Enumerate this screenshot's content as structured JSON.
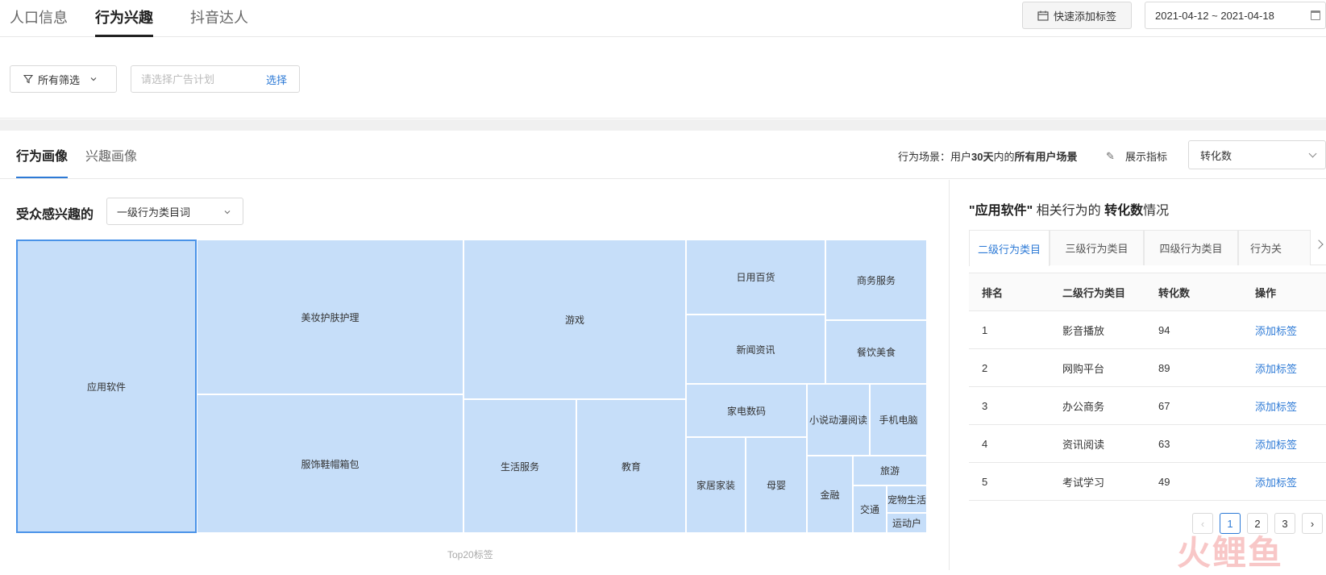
{
  "top_tabs": [
    "人口信息",
    "行为兴趣",
    "抖音达人"
  ],
  "quick_tag_label": "快速添加标签",
  "date_range": "2021-04-12 ~ 2021-04-18",
  "filter": {
    "all_filter_label": "所有筛选",
    "plan_placeholder": "请选择广告计划",
    "select_label": "选择"
  },
  "section_tabs": [
    "行为画像",
    "兴趣画像"
  ],
  "scene": {
    "prefix": "行为场景：用户",
    "days": "30天",
    "mid": "内的",
    "scene_name": "所有用户场景"
  },
  "metric": {
    "label": "展示指标",
    "value": "转化数"
  },
  "left": {
    "audience_label": "受众感兴趣的",
    "level_select": "一级行为类目词",
    "treemap": [
      "应用软件",
      "美妆护肤护理",
      "服饰鞋帽箱包",
      "游戏",
      "生活服务",
      "教育",
      "日用百货",
      "商务服务",
      "新闻资讯",
      "餐饮美食",
      "家电数码",
      "小说动漫阅读",
      "手机电脑",
      "家居家装",
      "母婴",
      "金融",
      "旅游",
      "交通",
      "宠物生活",
      "运动户"
    ],
    "caption": "Top20标签"
  },
  "right": {
    "title_category": "\"应用软件\"",
    "title_mid": "相关行为的",
    "title_metric": "转化数",
    "title_suffix": "情况",
    "tabs": [
      "二级行为类目",
      "三级行为类目",
      "四级行为类目",
      "行为关"
    ],
    "table": {
      "headers": [
        "排名",
        "二级行为类目",
        "转化数",
        "操作"
      ],
      "rows": [
        [
          "1",
          "影音播放",
          "94",
          "添加标签"
        ],
        [
          "2",
          "网购平台",
          "89",
          "添加标签"
        ],
        [
          "3",
          "办公商务",
          "67",
          "添加标签"
        ],
        [
          "4",
          "资讯阅读",
          "63",
          "添加标签"
        ],
        [
          "5",
          "考试学习",
          "49",
          "添加标签"
        ]
      ]
    },
    "pager": {
      "prev": "‹",
      "pages": [
        "1",
        "2",
        "3"
      ],
      "next": "›"
    }
  },
  "watermark": "火鲤鱼"
}
